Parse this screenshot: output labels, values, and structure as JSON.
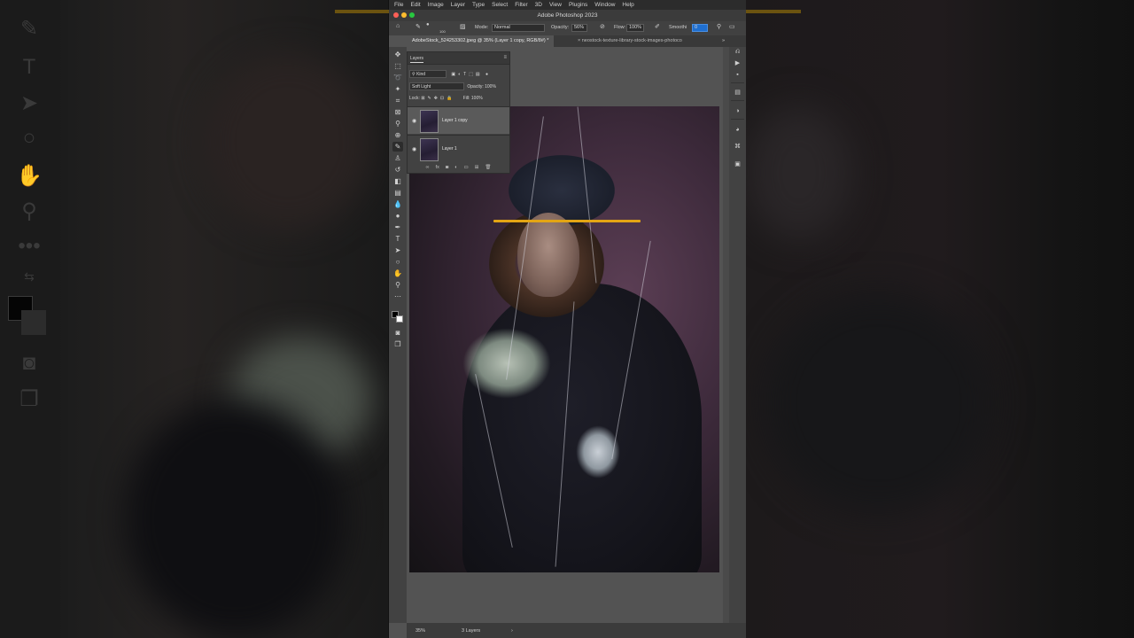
{
  "menubar": {
    "items": [
      "File",
      "Edit",
      "Image",
      "Layer",
      "Type",
      "Select",
      "Filter",
      "3D",
      "View",
      "Plugins",
      "Window",
      "Help"
    ]
  },
  "app": {
    "title": "Adobe Photoshop 2023"
  },
  "options": {
    "size": "100",
    "mode_label": "Mode:",
    "mode_value": "Normal",
    "opacity_label": "Opacity:",
    "opacity_value": "56%",
    "flow_label": "Flow:",
    "flow_value": "100%",
    "smoothing_label": "Smoothi",
    "smoothing_value": "0"
  },
  "tabs": [
    {
      "label": "AdobeStock_524253302.jpeg @ 35% (Layer 1 copy, RGB/8#) *",
      "active": true
    },
    {
      "label": "neostock-texture-library-stock-images-photoco",
      "active": false
    }
  ],
  "layers_panel": {
    "title": "Layers",
    "filter": "Kind",
    "blend_mode": "Soft Light",
    "opacity_label": "Opacity:",
    "opacity_value": "100%",
    "lock_label": "Lock:",
    "fill_label": "Fill:",
    "fill_value": "100%",
    "layers": [
      {
        "name": "Layer 1 copy",
        "selected": true
      },
      {
        "name": "Layer 1",
        "selected": false
      }
    ]
  },
  "status": {
    "zoom": "35%",
    "info": "3 Layers"
  },
  "colors": {
    "accent_gold": "#e3a514"
  }
}
